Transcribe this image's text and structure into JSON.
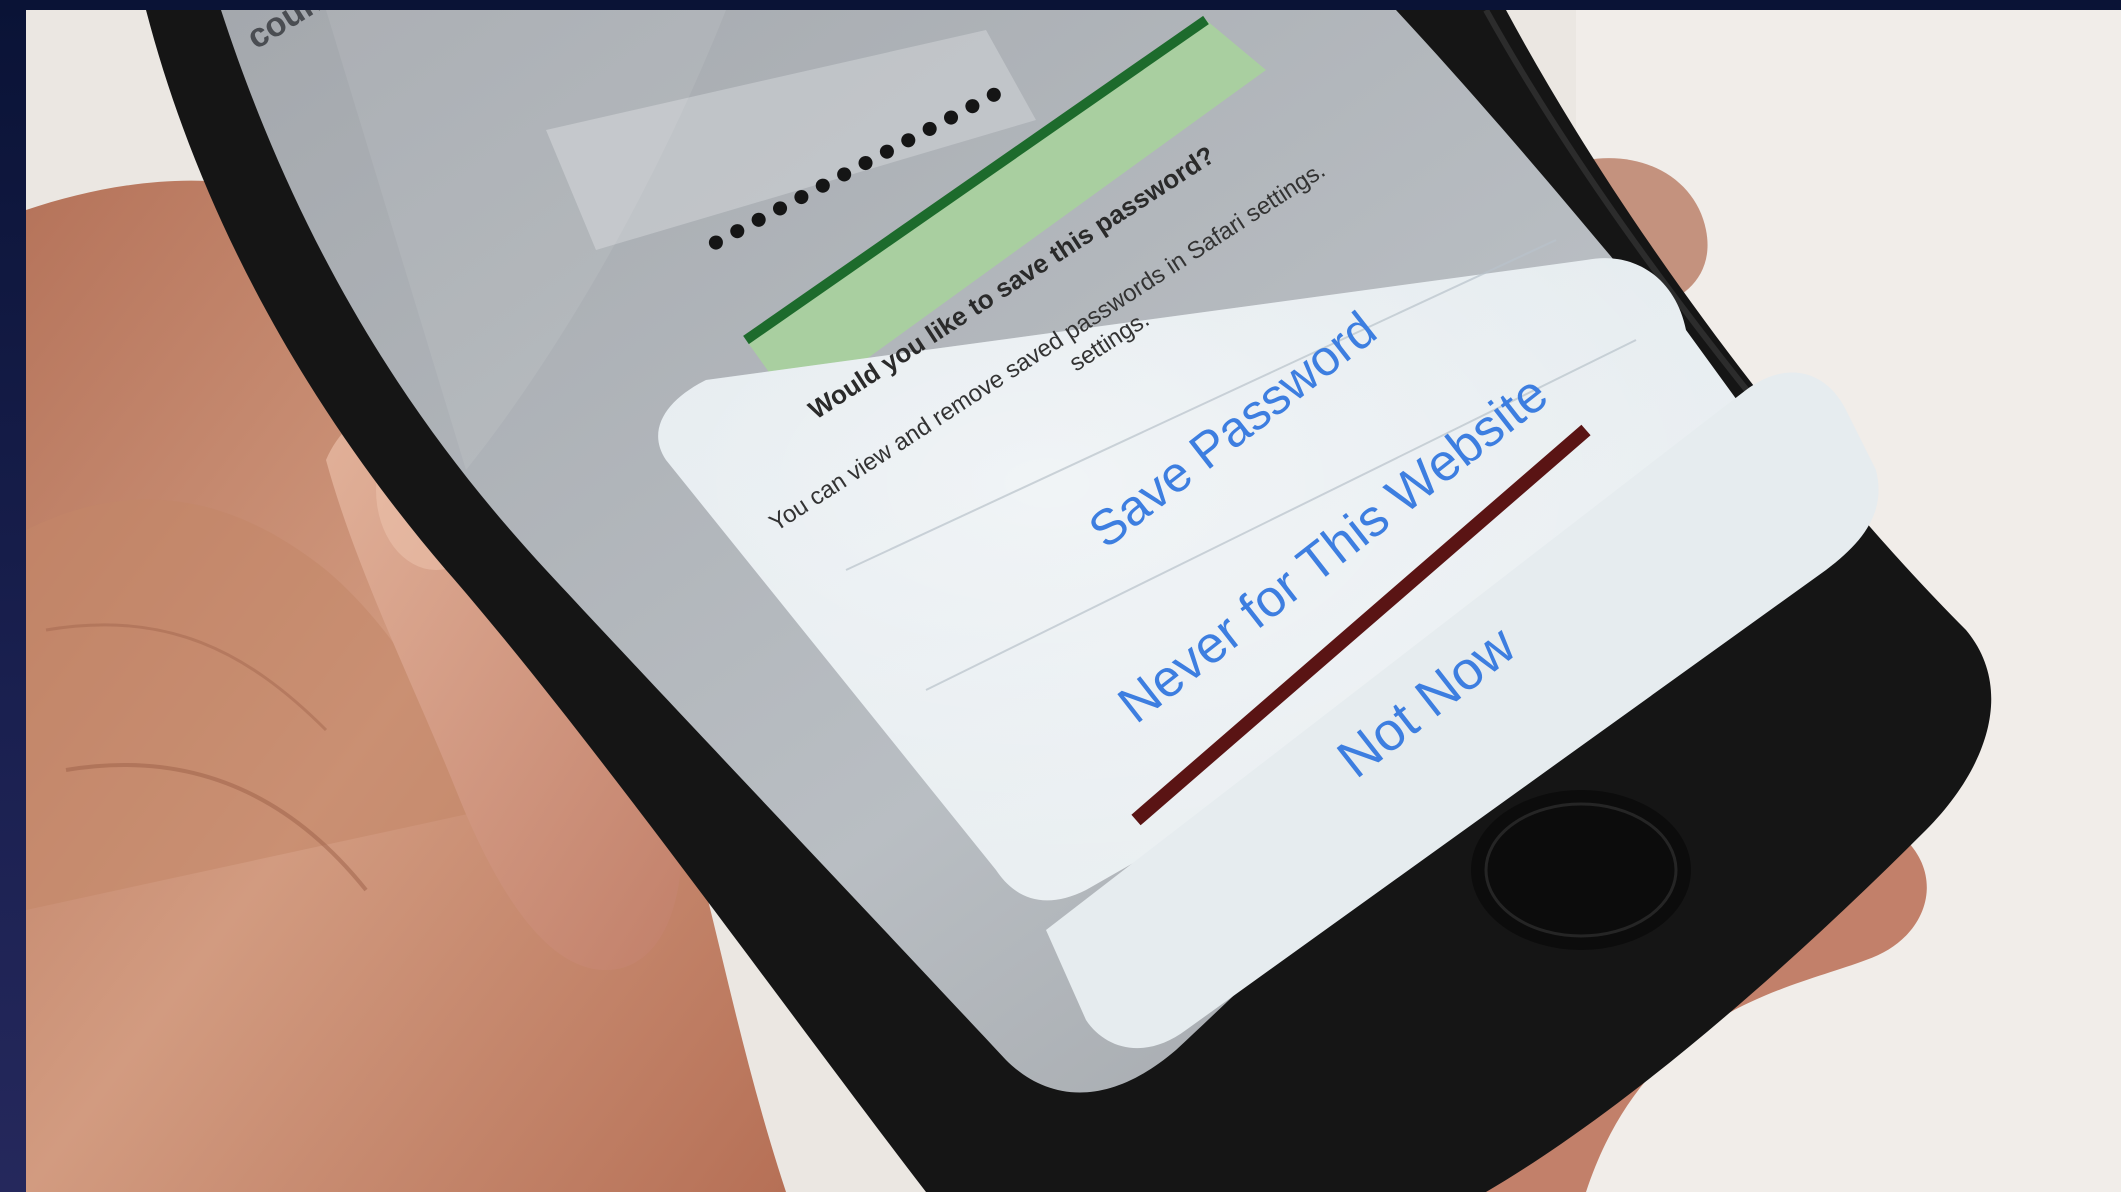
{
  "scene": {
    "description_alt": "Hand holding a phone showing a save password prompt"
  },
  "header_fragment": "count",
  "password_mask": "••••••••••••••",
  "dialog": {
    "title": "Would you like to save this password?",
    "message": "You can view and remove saved passwords in Safari settings.",
    "message_line2": "settings.",
    "buttons": {
      "save": "Save Password",
      "never": "Never for This Website",
      "not_now": "Not Now"
    }
  },
  "colors": {
    "link_blue": "#3d7ee0",
    "dialog_bg": "#e8eef2",
    "phone_body": "#141414",
    "skin": "#c98a6c"
  }
}
